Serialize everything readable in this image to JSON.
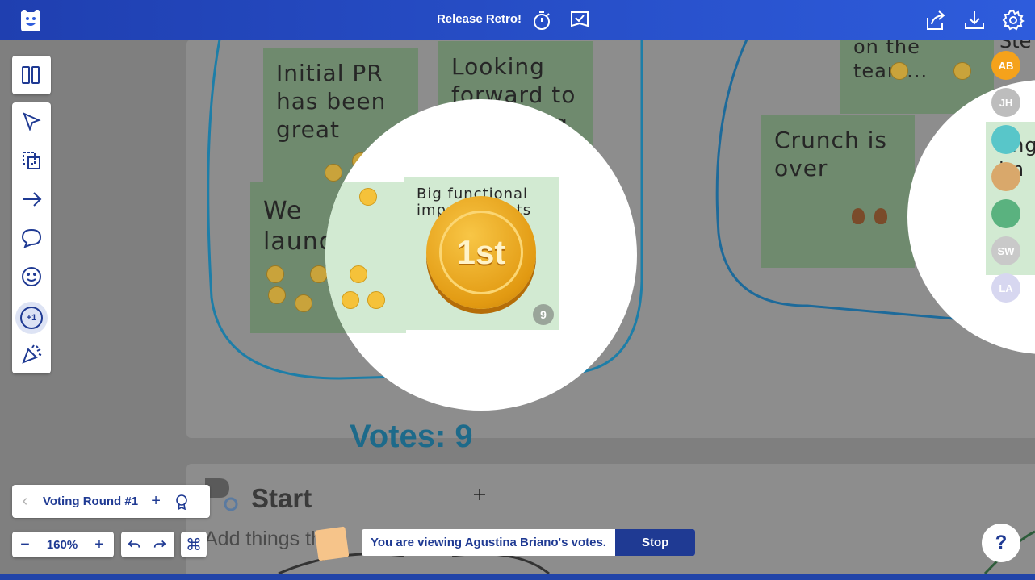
{
  "header": {
    "title": "Release Retro!",
    "icons": [
      "timer-icon",
      "checklist-flag-icon",
      "share-icon",
      "download-icon",
      "gear-icon"
    ]
  },
  "board": {
    "stickies": [
      {
        "text": "Initial PR has been great"
      },
      {
        "text": "Looking forward to reviewing usage"
      },
      {
        "text": "We launched!"
      },
      {
        "text": "Big functional improvements",
        "vote_count": "9"
      },
      {
        "text": "Crunch is over"
      },
      {
        "text": "on the team..."
      },
      {
        "text": "Ste"
      },
      {
        "text": "Eng im"
      }
    ],
    "medal_text": "1st",
    "votes_label": "Votes: 9",
    "section_title": "Start",
    "section_subtitle": "Add things th"
  },
  "avatars": [
    {
      "initials": "AB",
      "color": "#f5a21b"
    },
    {
      "initials": "JH",
      "color": "#9c9c9c"
    },
    {
      "initials": "",
      "color": "#58c6c9"
    },
    {
      "initials": "",
      "color": "#d9a86b"
    },
    {
      "initials": "",
      "color": "#5ab27f"
    },
    {
      "initials": "SW",
      "color": "#c9c9c9"
    },
    {
      "initials": "LA",
      "color": "#d7d7f0"
    }
  ],
  "toolbar": {
    "tools": [
      "panels-icon",
      "select-cursor-icon",
      "multi-select-icon",
      "arrow-icon",
      "comment-icon",
      "emoji-icon",
      "vote-plus-one-icon",
      "celebrate-icon"
    ],
    "vote_label": "+1"
  },
  "voting": {
    "round_label": "Voting Round #1"
  },
  "zoom": {
    "level": "160%"
  },
  "viewing_banner": {
    "message": "You are viewing Agustina Briano's votes.",
    "stop_label": "Stop"
  },
  "help": {
    "label": "?"
  }
}
